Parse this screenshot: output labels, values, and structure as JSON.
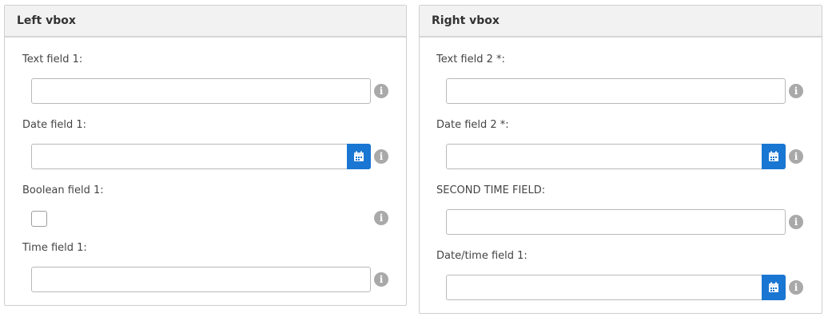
{
  "left_panel": {
    "title": "Left vbox",
    "fields": {
      "text1_label": "Text field 1:",
      "date1_label": "Date field 1:",
      "bool1_label": "Boolean field 1:",
      "time1_label": "Time field 1:"
    }
  },
  "right_panel": {
    "title": "Right vbox",
    "fields": {
      "text2_label": "Text field 2 *:",
      "date2_label": "Date field 2 *:",
      "second_time_label": "SECOND TIME FIELD:",
      "datetime1_label": "Date/time field 1:"
    }
  },
  "icons": {
    "info": "i",
    "calendar": "calendar-icon"
  },
  "colors": {
    "accent": "#1976d2",
    "info_icon": "#a9a9a9"
  }
}
